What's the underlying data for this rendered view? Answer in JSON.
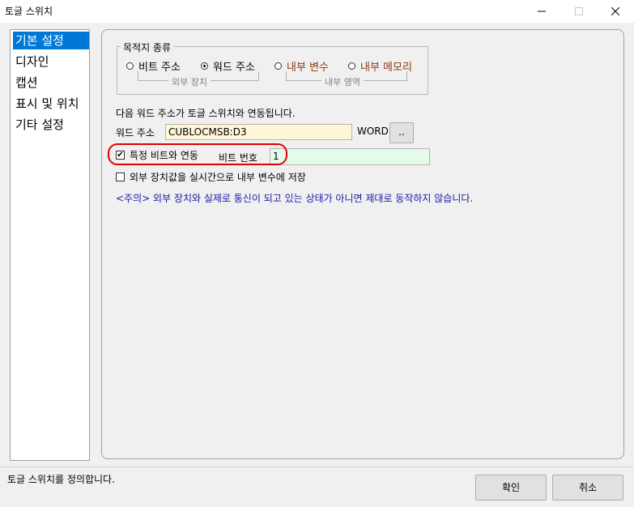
{
  "window": {
    "title": "토글 스위치",
    "controls": {
      "minimize": "minimize-icon",
      "maximize": "maximize-icon",
      "close": "close-icon"
    }
  },
  "sidebar": {
    "items": [
      {
        "label": "기본 설정",
        "selected": true
      },
      {
        "label": "디자인",
        "selected": false
      },
      {
        "label": "캡션",
        "selected": false
      },
      {
        "label": "표시 및 위치",
        "selected": false
      },
      {
        "label": "기타 설정",
        "selected": false
      }
    ]
  },
  "destination": {
    "legend": "목적지 종류",
    "options": [
      {
        "label": "비트 주소",
        "selected": false
      },
      {
        "label": "워드 주소",
        "selected": true
      },
      {
        "label": "내부 변수",
        "selected": false
      },
      {
        "label": "내부 메모리",
        "selected": false
      }
    ],
    "group_external": "외부 장치",
    "group_internal": "내부 영역"
  },
  "main": {
    "description": "다음 워드 주소가 토글 스위치와 연동됩니다.",
    "address_label": "워드 주소",
    "address_value": "CUBLOCMSB:D3",
    "word_label": "WORD",
    "browse_label": "..",
    "specific_bit_label": "특정 비트와 연동",
    "specific_bit_checked": true,
    "bit_number_label": "비트 번호",
    "bit_number_value": "1",
    "save_realtime_label": "외부 장치값을 실시간으로 내부 변수에 저장",
    "save_realtime_checked": false,
    "caution": "<주의> 외부 장치와 실제로 통신이 되고 있는 상태가 아니면 제대로 동작하지 않습니다."
  },
  "footer": {
    "status": "토글 스위치를 정의합니다.",
    "ok": "확인",
    "cancel": "취소"
  },
  "colors": {
    "selection": "#0078d7",
    "address_bg": "#fff6d8",
    "bit_bg": "#e5fbe9",
    "highlight": "#e10000",
    "caution_text": "#1a1aa8",
    "internal_option_text": "#8b3a10"
  }
}
